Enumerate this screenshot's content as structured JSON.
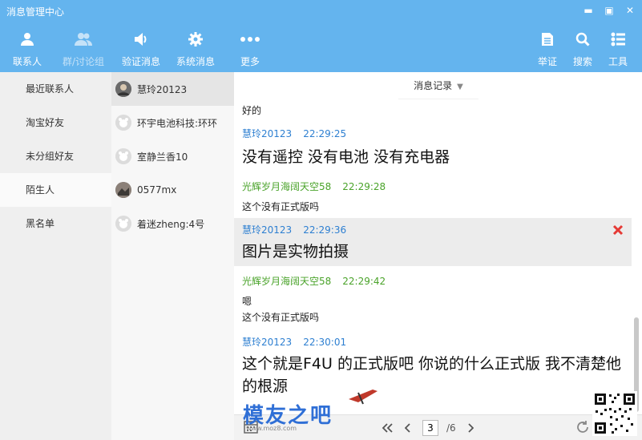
{
  "window": {
    "title": "消息管理中心",
    "controls": [
      "▬",
      "▣",
      "✕"
    ]
  },
  "toolbar": {
    "left": [
      {
        "label": "联系人",
        "icon": "person-icon",
        "active": true
      },
      {
        "label": "群/讨论组",
        "icon": "group-icon",
        "dim": true
      },
      {
        "label": "验证消息",
        "icon": "speaker-icon"
      },
      {
        "label": "系统消息",
        "icon": "gear-icon"
      },
      {
        "label": "更多",
        "icon": "more-dots-icon"
      }
    ],
    "right": [
      {
        "label": "举证",
        "icon": "document-icon"
      },
      {
        "label": "搜索",
        "icon": "search-icon"
      },
      {
        "label": "工具",
        "icon": "tools-list-icon"
      }
    ]
  },
  "sidebar": {
    "items": [
      "最近联系人",
      "淘宝好友",
      "未分组好友",
      "陌生人",
      "黑名单"
    ],
    "selected_index": 3
  },
  "contacts": [
    {
      "name": "慧玲20123",
      "avatar": "photo",
      "selected": true
    },
    {
      "name": "环宇电池科技:环环",
      "avatar": "default"
    },
    {
      "name": "室静兰香10",
      "avatar": "default"
    },
    {
      "name": "0577mx",
      "avatar": "photo2"
    },
    {
      "name": "着迷zheng:4号",
      "avatar": "default"
    }
  ],
  "chat": {
    "tab_label": "消息记录",
    "messages": [
      {
        "sender": "",
        "time": "",
        "lines": [
          "好的"
        ],
        "size": "small",
        "role": "other"
      },
      {
        "sender": "慧玲20123",
        "time": "22:29:25",
        "lines": [
          "没有遥控 没有电池 没有充电器"
        ],
        "size": "big",
        "role": "me"
      },
      {
        "sender": "光辉岁月海阔天空58",
        "time": "22:29:28",
        "lines": [
          "这个没有正式版吗"
        ],
        "size": "small",
        "role": "other"
      },
      {
        "sender": "慧玲20123",
        "time": "22:29:36",
        "lines": [
          "图片是实物拍摄"
        ],
        "size": "big",
        "role": "me",
        "highlight": true
      },
      {
        "sender": "光辉岁月海阔天空58",
        "time": "22:29:42",
        "lines": [
          "嗯",
          "这个没有正式版吗"
        ],
        "size": "small",
        "role": "other"
      },
      {
        "sender": "慧玲20123",
        "time": "22:30:01",
        "lines": [
          "这个就是F4U 的正式版吧  你说的什么正式版  我不清楚他",
          "的根源"
        ],
        "size": "big",
        "role": "me"
      }
    ],
    "pager": {
      "current": "3",
      "total_label": "/6"
    }
  },
  "watermark": {
    "text": "模友之吧",
    "url": "www.moz8.com"
  },
  "colors": {
    "header": "#64b4ee",
    "me_name": "#2d7fd1",
    "other_name": "#4aa32a",
    "delete": "#e53935"
  }
}
